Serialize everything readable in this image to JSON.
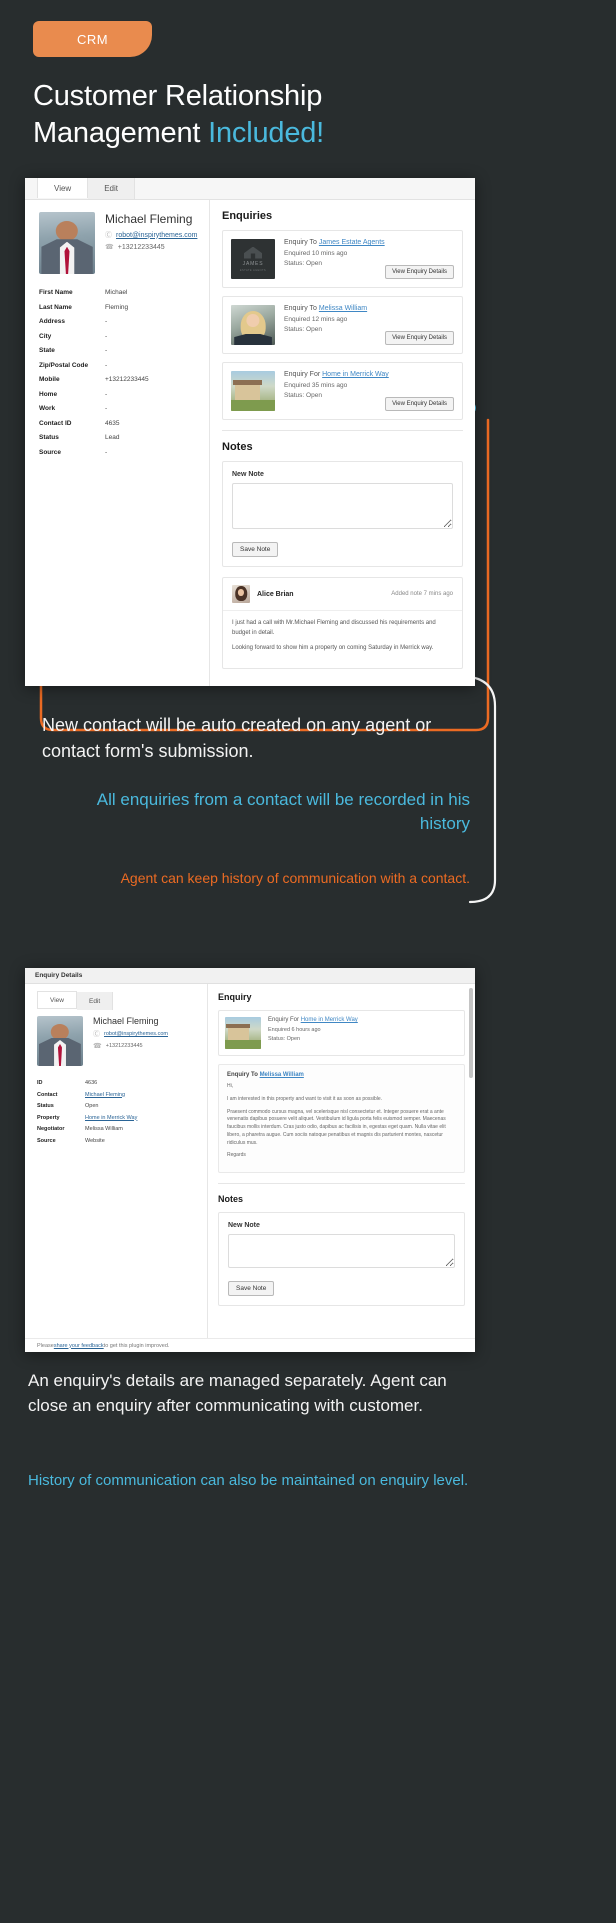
{
  "badge": {
    "label": "CRM"
  },
  "heading": {
    "line1": "Customer Relationship",
    "line2": "Management ",
    "accent": "Included!"
  },
  "colors": {
    "background": "#282d2e",
    "orange": "#e98b4e",
    "blue": "#4ab9dd",
    "orange_text": "#ec6b23",
    "link": "#3f87c4"
  },
  "shot1": {
    "tabs": [
      {
        "label": "View",
        "active": true
      },
      {
        "label": "Edit",
        "active": false
      }
    ],
    "contact": {
      "name": "Michael Fleming",
      "email": "robot@inspirythemes.com",
      "phone": "+13212233445",
      "fields": [
        {
          "label": "First Name",
          "value": "Michael"
        },
        {
          "label": "Last Name",
          "value": "Fleming"
        },
        {
          "label": "Address",
          "value": "-"
        },
        {
          "label": "City",
          "value": "-"
        },
        {
          "label": "State",
          "value": "-"
        },
        {
          "label": "Zip/Postal Code",
          "value": "-"
        },
        {
          "label": "Mobile",
          "value": "+13212233445"
        },
        {
          "label": "Home",
          "value": "-"
        },
        {
          "label": "Work",
          "value": "-"
        },
        {
          "label": "Contact ID",
          "value": "4635"
        },
        {
          "label": "Status",
          "value": "Lead"
        },
        {
          "label": "Source",
          "value": "-"
        }
      ]
    },
    "enquiries": {
      "title": "Enquiries",
      "items": [
        {
          "prefix": "Enquiry To ",
          "target": "James Estate Agents",
          "time": "Enquired 10 mins ago",
          "status": "Status: Open",
          "button": "View Enquiry Details",
          "thumb": "james-logo"
        },
        {
          "prefix": "Enquiry To ",
          "target": "Melissa William",
          "time": "Enquired 12 mins ago",
          "status": "Status: Open",
          "button": "View Enquiry Details",
          "thumb": "agent-photo"
        },
        {
          "prefix": "Enquiry For ",
          "target": "Home in Merrick Way",
          "time": "Enquired 35 mins ago",
          "status": "Status: Open",
          "button": "View Enquiry Details",
          "thumb": "property-photo"
        }
      ]
    },
    "notes": {
      "title": "Notes",
      "new_note_label": "New Note",
      "new_note_value": "",
      "save_button": "Save Note",
      "entries": [
        {
          "author": "Alice Brian",
          "time": "Added note 7 mins ago",
          "paragraphs": [
            "I just had a call with Mr.Michael Fleming and discussed his requirements and budget in detail.",
            "Looking forward to show him a property on coming Saturday in Merrick way."
          ]
        }
      ]
    }
  },
  "shot2": {
    "window_title": "Enquiry Details",
    "tabs": [
      {
        "label": "View",
        "active": true
      },
      {
        "label": "Edit",
        "active": false
      }
    ],
    "contact": {
      "name": "Michael Fleming",
      "email": "robot@inspirythemes.com",
      "phone": "+13212233445",
      "fields": [
        {
          "label": "ID",
          "value": "4636",
          "link": false
        },
        {
          "label": "Contact",
          "value": "Michael Fleming",
          "link": true
        },
        {
          "label": "Status",
          "value": "Open",
          "link": false
        },
        {
          "label": "Property",
          "value": "Home in Merrick Way",
          "link": true
        },
        {
          "label": "Negotiator",
          "value": "Melissa William",
          "link": false
        },
        {
          "label": "Source",
          "value": "Website",
          "link": false
        }
      ]
    },
    "enquiry": {
      "title": "Enquiry",
      "header": {
        "prefix": "Enquiry For ",
        "target": "Home in Merrick Way",
        "time": "Enquired 6 hours ago",
        "status": "Status: Open"
      },
      "message": {
        "to_prefix": "Enquiry To ",
        "to_target": "Melissa William",
        "paragraphs": [
          "Hi,",
          "I am interested in this property and want to visit it as soon as possible.",
          "Praesent commodo cursus magna, vel scelerisque nisl consectetur et. Integer posuere erat a ante venenatis dapibus posuere velit aliquet. Vestibulum id ligula porta felis euismod semper. Maecenas faucibus mollis interdum. Cras justo odio, dapibus ac facilisis in, egestas eget quam. Nulla vitae elit libero, a pharetra augue. Cum sociis natoque penatibus et magnis dis parturient montes, nascetur ridiculus mus.",
          "Regards"
        ]
      }
    },
    "notes": {
      "title": "Notes",
      "new_note_label": "New Note",
      "new_note_value": "",
      "save_button": "Save Note"
    },
    "footer": {
      "prefix": "Please ",
      "link": "share your feedback",
      "suffix": " to get this plugin improved."
    }
  },
  "callouts": {
    "c1": "New contact will be auto created on any agent or contact form's submission.",
    "c2": "All enquiries from a contact will be recorded in his history",
    "c3": "Agent can keep history of communication with a contact.",
    "c4": "An enquiry's details are managed separately. Agent can close an enquiry after communicating with customer.",
    "c5": "History of communication can also be maintained on enquiry level."
  }
}
